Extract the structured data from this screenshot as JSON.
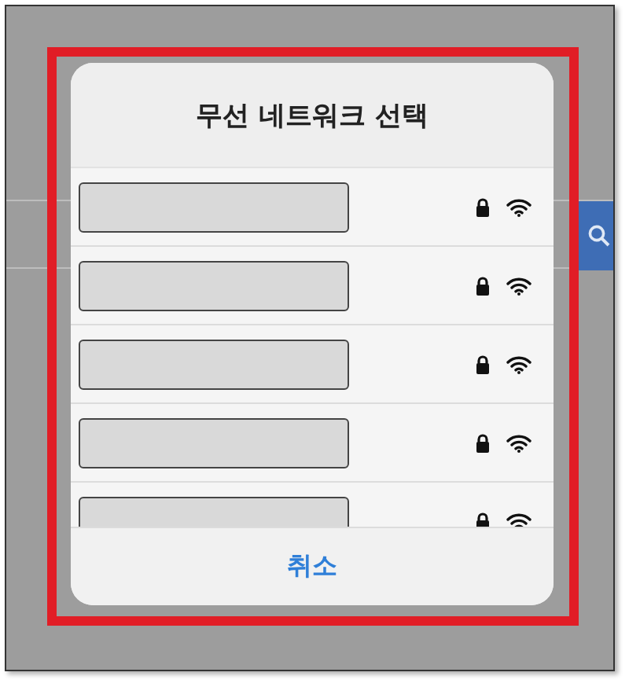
{
  "dialog": {
    "title": "무선 네트워크 선택",
    "networks": [
      {
        "kind": "redacted",
        "secured": true
      },
      {
        "kind": "redacted",
        "secured": true
      },
      {
        "kind": "redacted",
        "secured": true
      },
      {
        "kind": "redacted",
        "secured": true
      },
      {
        "kind": "redacted",
        "secured": true
      }
    ],
    "cancel": "취소"
  }
}
